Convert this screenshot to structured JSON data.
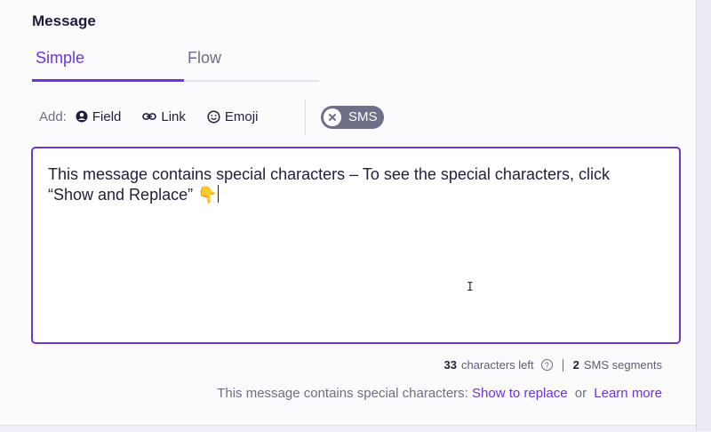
{
  "section_title": "Message",
  "tabs": [
    {
      "label": "Simple",
      "active": true
    },
    {
      "label": "Flow",
      "active": false
    }
  ],
  "toolbar": {
    "add_label": "Add:",
    "field_label": "Field",
    "link_label": "Link",
    "emoji_label": "Emoji",
    "sms_toggle_label": "SMS",
    "sms_toggle_on": false
  },
  "editor": {
    "text": "This message contains special characters – To see the special characters, click “Show and Replace” 👇"
  },
  "counter": {
    "chars_left": "33",
    "chars_left_label": "characters left",
    "help_glyph": "?",
    "segments": "2",
    "segments_label": "SMS segments"
  },
  "notice": {
    "text": "This message contains special characters:",
    "show_link": "Show to replace",
    "or_text": "or",
    "learn_link": "Learn more"
  },
  "colors": {
    "accent": "#6b35d8",
    "toggle_bg": "#6e6f88",
    "text": "#1f1f3a"
  }
}
